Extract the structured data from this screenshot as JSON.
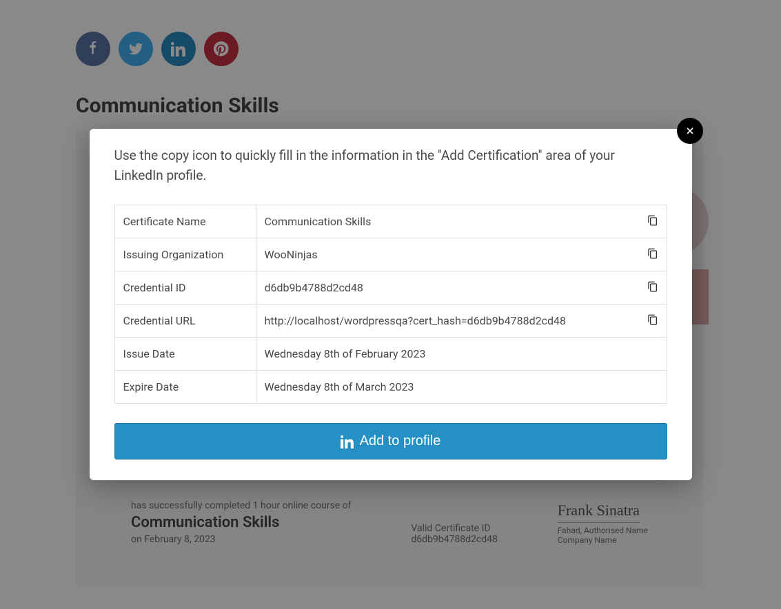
{
  "page": {
    "title": "Communication Skills"
  },
  "certificate": {
    "completed_line": "has successfully completed 1 hour online course of",
    "course_name": "Communication Skills",
    "on_date": "on February 8, 2023",
    "valid_label": "Valid Certificate ID",
    "valid_id": "d6db9b4788d2cd48",
    "signature_name": "Frank Sinatra",
    "auth_name": "Fahad, Authorised Name",
    "company": "Company Name"
  },
  "modal": {
    "instruction": "Use the copy icon to quickly fill in the information in the \"Add Certification\" area of your LinkedIn profile.",
    "rows": [
      {
        "label": "Certificate Name",
        "value": "Communication Skills",
        "copyable": true
      },
      {
        "label": "Issuing Organization",
        "value": "WooNinjas",
        "copyable": true
      },
      {
        "label": "Credential ID",
        "value": "d6db9b4788d2cd48",
        "copyable": true
      },
      {
        "label": "Credential URL",
        "value": "http://localhost/wordpressqa?cert_hash=d6db9b4788d2cd48",
        "copyable": true
      },
      {
        "label": "Issue Date",
        "value": "Wednesday 8th of February 2023",
        "copyable": false
      },
      {
        "label": "Expire Date",
        "value": "Wednesday 8th of March 2023",
        "copyable": false
      }
    ],
    "button_label": "Add to profile"
  }
}
